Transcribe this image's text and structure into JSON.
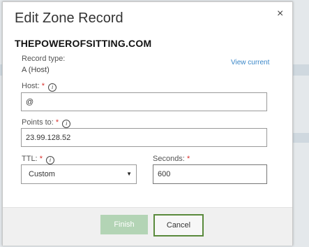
{
  "dialog": {
    "title": "Edit Zone Record",
    "close_glyph": "×",
    "domain": "THEPOWEROFSITTING.COM"
  },
  "record_type": {
    "label": "Record type:",
    "value": "A (Host)",
    "view_current": "View current"
  },
  "host": {
    "label": "Host:",
    "required": "*",
    "info_glyph": "i",
    "value": "@"
  },
  "points_to": {
    "label": "Points to:",
    "required": "*",
    "info_glyph": "i",
    "value": "23.99.128.52"
  },
  "ttl": {
    "label": "TTL:",
    "required": "*",
    "info_glyph": "i",
    "selected": "Custom",
    "arrow_glyph": "▼"
  },
  "seconds": {
    "label": "Seconds:",
    "required": "*",
    "value": "600"
  },
  "footer": {
    "finish_label": "Finish",
    "cancel_label": "Cancel"
  },
  "colors": {
    "accent_green": "#5a8a3c",
    "disabled_green": "#b3d4b5",
    "link_blue": "#3a87c8",
    "required_red": "#d9302c"
  },
  "icons": {
    "close": "close-icon",
    "info": "info-icon",
    "dropdown": "chevron-down-icon"
  }
}
